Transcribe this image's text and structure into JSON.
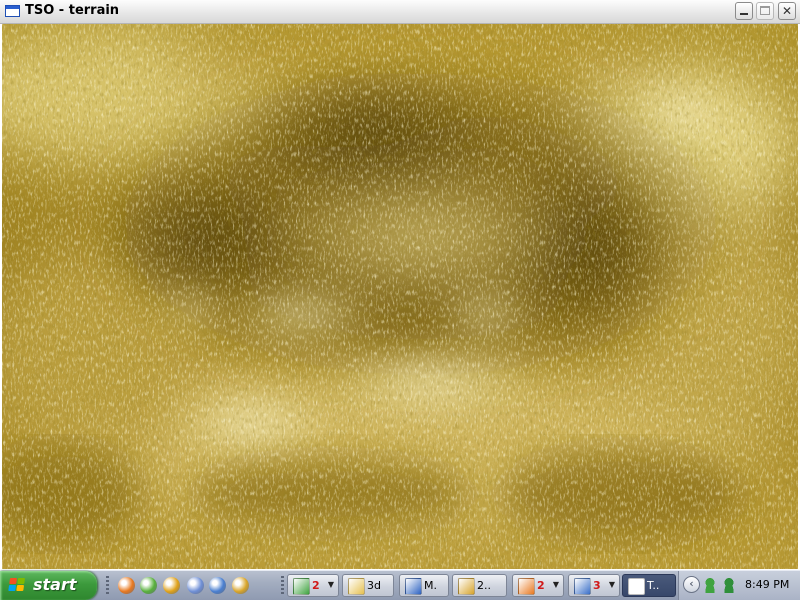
{
  "window": {
    "title": "TSO - terrain",
    "close_glyph": "✕",
    "icon": "app-window-icon"
  },
  "viewport": {
    "description_icon": "terrain-render",
    "palette": {
      "dark": "#5e4a0e",
      "mid": "#a88b27",
      "light": "#d7c56b",
      "highlight": "#fbf4d2"
    }
  },
  "taskbar": {
    "start_label": "start",
    "quick_launch": [
      {
        "icon": "firefox-icon",
        "color": "#e8781f"
      },
      {
        "icon": "utorrent-icon",
        "color": "#58b03b"
      },
      {
        "icon": "winamp-icon",
        "color": "#e0a21a"
      },
      {
        "icon": "bulb-icon",
        "color": "#6f8fd6"
      },
      {
        "icon": "paint-icon",
        "color": "#4a7fd0"
      },
      {
        "icon": "pencil-icon",
        "color": "#d9a52a"
      }
    ],
    "tasks": [
      {
        "name": "task-messenger",
        "icon": "messenger-icon",
        "color": "#3fa33f",
        "count": "2",
        "label": "",
        "arrow": "▼"
      },
      {
        "name": "task-folder-3d",
        "icon": "folder-icon",
        "color": "#e5c04f",
        "count": "",
        "label": "3d",
        "arrow": ""
      },
      {
        "name": "task-m",
        "icon": "m-app-icon",
        "color": "#2d62c2",
        "count": "",
        "label": "M.",
        "arrow": ""
      },
      {
        "name": "task-editor",
        "icon": "pencil-icon",
        "color": "#d6a32b",
        "count": "",
        "label": "2..",
        "arrow": ""
      },
      {
        "name": "task-firefox",
        "icon": "firefox-icon",
        "color": "#e8781f",
        "count": "2",
        "label": "",
        "arrow": "▼"
      },
      {
        "name": "task-windows",
        "icon": "window-group-icon",
        "color": "#3a6fc8",
        "count": "3",
        "label": "",
        "arrow": "▼"
      },
      {
        "name": "task-terrain",
        "icon": "app-window-icon",
        "color": "#ffffff",
        "count": "",
        "label": "T..",
        "arrow": ""
      }
    ],
    "tray": {
      "expand_glyph": "‹",
      "icons": [
        {
          "icon": "messenger-status-icon",
          "color": "#3fa33f"
        },
        {
          "icon": "network-icon",
          "color": "#2f8f3a"
        }
      ],
      "clock": "8:49 PM"
    }
  }
}
